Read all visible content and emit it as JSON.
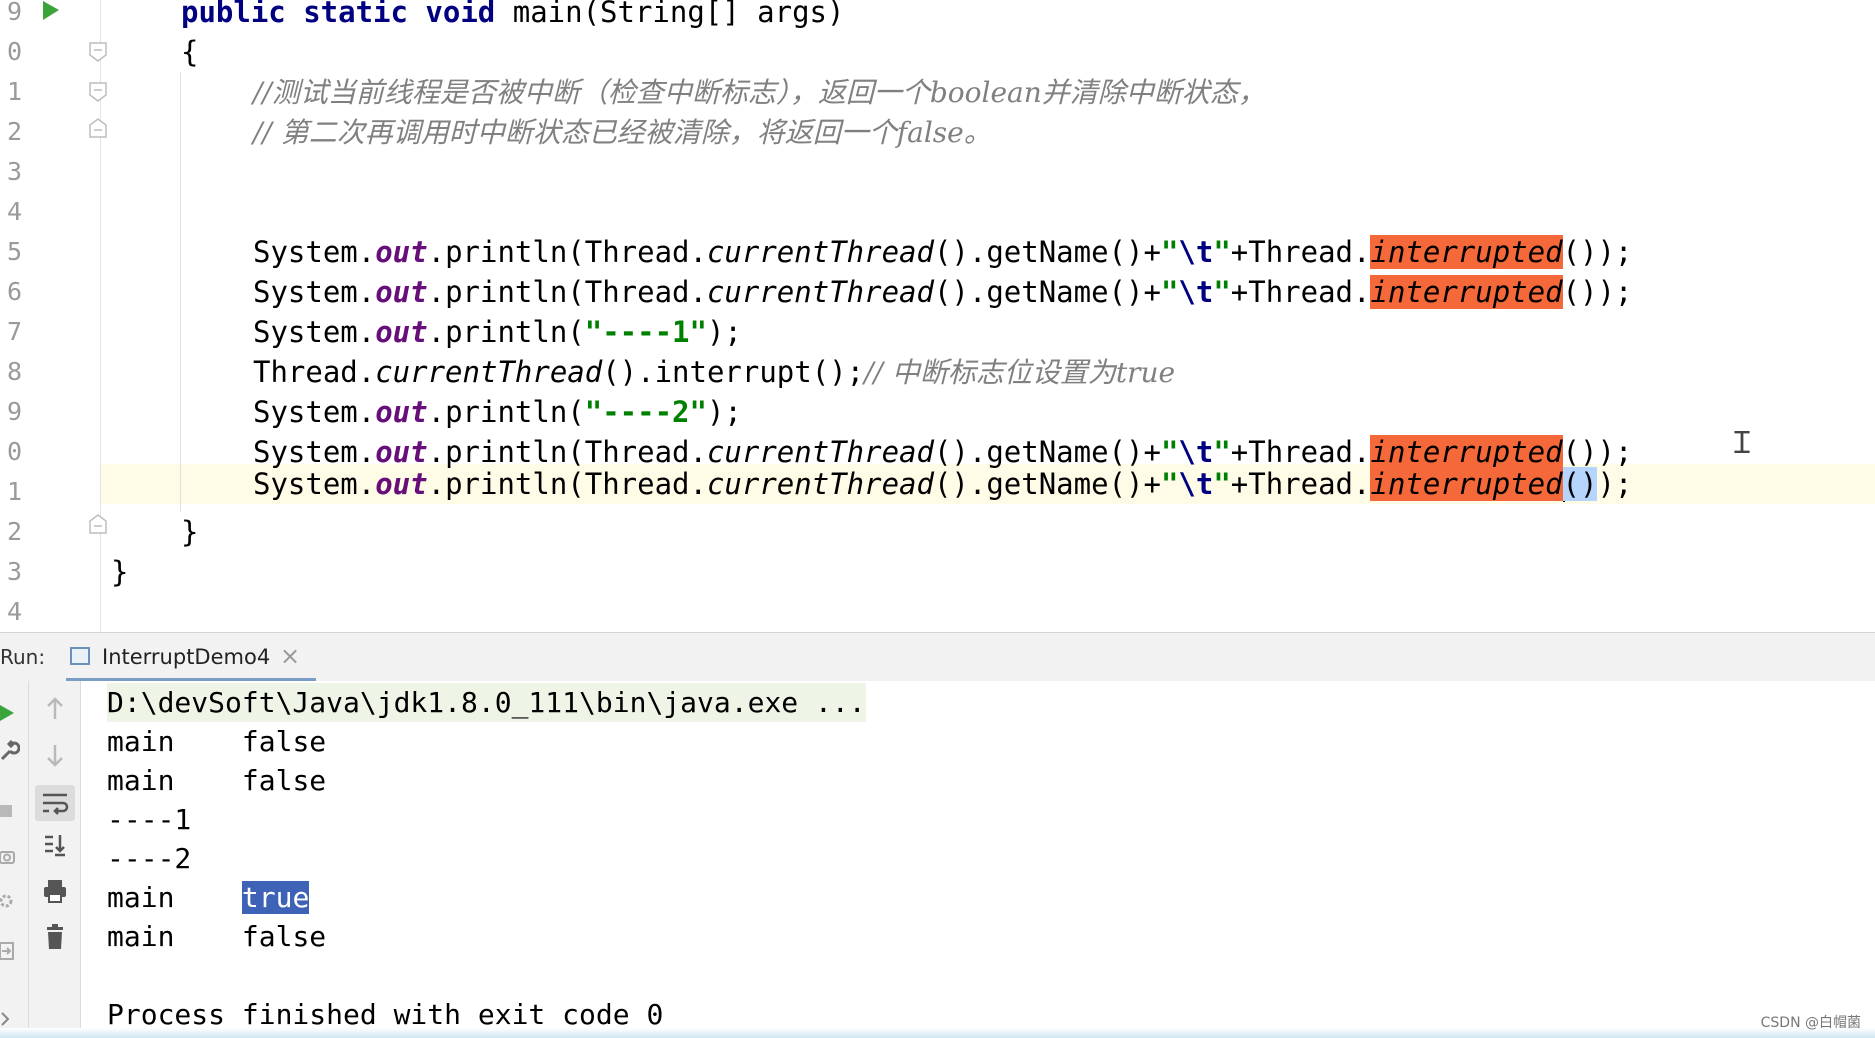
{
  "editor": {
    "line_numbers": [
      "9",
      "0",
      "1",
      "2",
      "3",
      "4",
      "5",
      "6",
      "7",
      "8",
      "9",
      "0",
      "1",
      "2",
      "3",
      "4"
    ],
    "code": {
      "main_signature": {
        "kw": "public static void",
        "rest": " main(String[] args)"
      },
      "open_brace": "{",
      "comment_1": "//测试当前线程是否被中断（检查中断标志），返回一个boolean并清除中断状态，",
      "comment_2": "// 第二次再调用时中断状态已经被清除，将返回一个false。",
      "println_prefix": "System.",
      "out": "out",
      "println_call": ".println(",
      "thread_prefix": "Thread.",
      "current_thread": "currentThread",
      "get_name": "().getName()+",
      "tab_open": "\"",
      "tab_escape": "\\t",
      "tab_close": "\"",
      "plus_thread": "+Thread.",
      "interrupted": "interrupted",
      "call_tail": "());",
      "open_paren_tail": "()",
      "close_tail": ");",
      "str_dash1": "\"----1\"",
      "str_dash2": "\"----2\"",
      "end_call": ");",
      "interrupt_call": "().interrupt();",
      "interrupt_comment": "// 中断标志位设置为true",
      "close_brace_inner": "}",
      "close_brace_outer": "}"
    }
  },
  "run_window": {
    "label": "Run:",
    "tab_title": "InterruptDemo4",
    "tab_close": "×",
    "console": {
      "command": "D:\\devSoft\\Java\\jdk1.8.0_111\\bin\\java.exe ...",
      "lines": [
        {
          "name": "main",
          "value": "false"
        },
        {
          "name": "main",
          "value": "false"
        },
        {
          "text": "----1"
        },
        {
          "text": "----2"
        },
        {
          "name": "main",
          "value": "true"
        },
        {
          "name": "main",
          "value": "false"
        }
      ],
      "exit_message": "Process finished with exit code 0"
    }
  },
  "watermark": "CSDN @白帽菌",
  "colors": {
    "highlight": "#f4683a",
    "keyword": "#000080",
    "string": "#008000",
    "field": "#660e7a",
    "comment": "#808080",
    "selection": "#3e63b6"
  }
}
